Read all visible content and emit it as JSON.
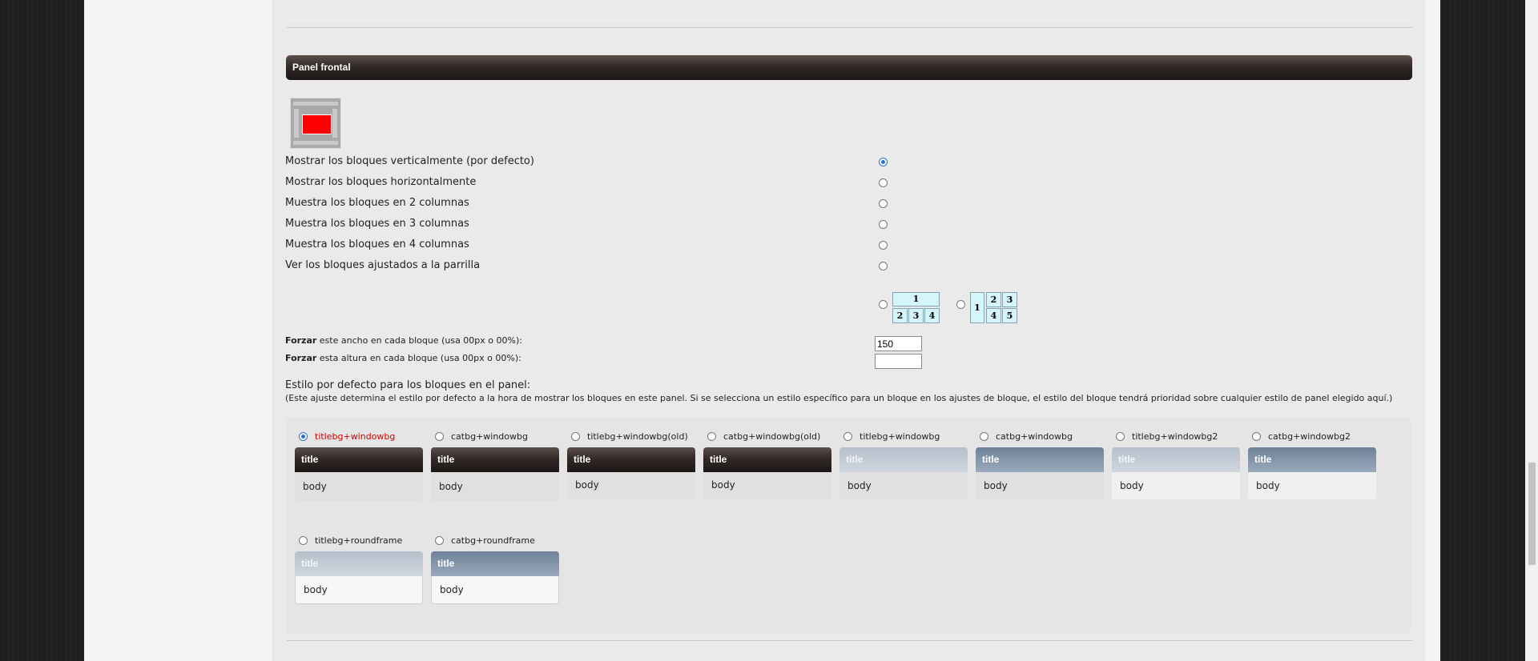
{
  "panel": {
    "title": "Panel frontal"
  },
  "layout_options": [
    {
      "label": "Mostrar los bloques verticalmente (por defecto)",
      "selected": true
    },
    {
      "label": "Mostrar los bloques horizontalmente",
      "selected": false
    },
    {
      "label": "Muestra los bloques en 2 columnas",
      "selected": false
    },
    {
      "label": "Muestra los bloques en 3 columnas",
      "selected": false
    },
    {
      "label": "Muestra los bloques en 4 columnas",
      "selected": false
    },
    {
      "label": "Ver los bloques ajustados a la parrilla",
      "selected": false
    }
  ],
  "grid_options": {
    "grid_a": {
      "top": "1",
      "cells": [
        "2",
        "3",
        "4"
      ]
    },
    "grid_b": {
      "left": "1",
      "cells": [
        "2",
        "3",
        "4",
        "5"
      ]
    }
  },
  "fields": {
    "width_bold": "Forzar",
    "width_text": " este ancho en cada bloque (usa 00px o 00%):",
    "width_value": "150",
    "height_bold": "Forzar",
    "height_text": " esta altura en cada bloque (usa 00px o 00%):",
    "height_value": ""
  },
  "default_style": {
    "title": "Estilo por defecto para los bloques en el panel:",
    "note": "(Este ajuste determina el estilo por defecto a la hora de mostrar los bloques en este panel. Si se selecciona un estilo específico para un bloque en los ajustes de bloque, el estilo del bloque tendrá prioridad sobre cualquier estilo de panel elegido aquí.)"
  },
  "styles": [
    {
      "label": "titlebg+windowbg",
      "title": "title",
      "body": "body",
      "selected": true
    },
    {
      "label": "catbg+windowbg",
      "title": "title",
      "body": "body",
      "selected": false
    },
    {
      "label": "titlebg+windowbg(old)",
      "title": "title",
      "body": "body",
      "selected": false
    },
    {
      "label": "catbg+windowbg(old)",
      "title": "title",
      "body": "body",
      "selected": false
    },
    {
      "label": "titlebg+windowbg",
      "title": "title",
      "body": "body",
      "selected": false
    },
    {
      "label": "catbg+windowbg",
      "title": "title",
      "body": "body",
      "selected": false
    },
    {
      "label": "titlebg+windowbg2",
      "title": "title",
      "body": "body",
      "selected": false
    },
    {
      "label": "catbg+windowbg2",
      "title": "title",
      "body": "body",
      "selected": false
    },
    {
      "label": "titlebg+roundframe",
      "title": "title",
      "body": "body",
      "selected": false
    },
    {
      "label": "catbg+roundframe",
      "title": "title",
      "body": "body",
      "selected": false
    }
  ],
  "colors": {
    "header_dark": "#2e2523",
    "selected_radio": "#2a72d4",
    "active_style_label": "#d40000",
    "highlight_block": "#ff0000",
    "grid_cell": "#d6f4fb"
  }
}
